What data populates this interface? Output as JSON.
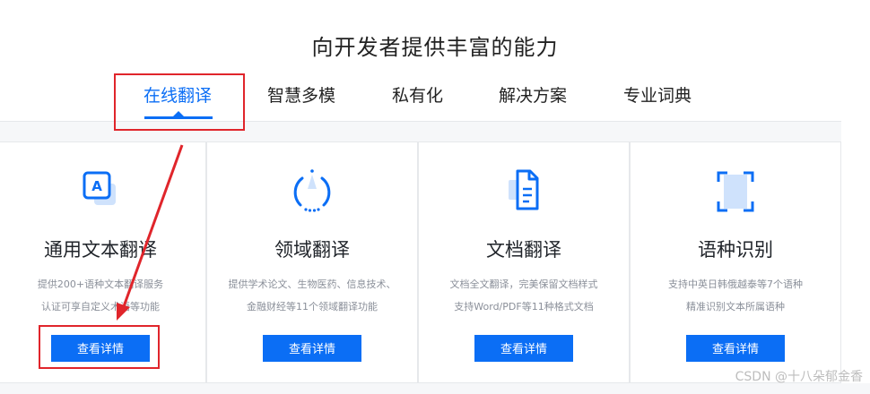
{
  "heading": "向开发者提供丰富的能力",
  "tabs": [
    {
      "label": "在线翻译",
      "active": true
    },
    {
      "label": "智慧多模",
      "active": false
    },
    {
      "label": "私有化",
      "active": false
    },
    {
      "label": "解决方案",
      "active": false
    },
    {
      "label": "专业词典",
      "active": false
    }
  ],
  "cards": [
    {
      "icon": "text-translate-icon",
      "title": "通用文本翻译",
      "desc": [
        "提供200+语种文本翻译服务",
        "认证可享自定义术语等功能"
      ],
      "button": "查看详情"
    },
    {
      "icon": "domain-translate-icon",
      "title": "领域翻译",
      "desc": [
        "提供学术论文、生物医药、信息技术、",
        "金融财经等11个领域翻译功能"
      ],
      "button": "查看详情"
    },
    {
      "icon": "document-translate-icon",
      "title": "文档翻译",
      "desc": [
        "文档全文翻译，完美保留文档样式",
        "支持Word/PDF等11种格式文档"
      ],
      "button": "查看详情"
    },
    {
      "icon": "language-detect-icon",
      "title": "语种识别",
      "desc": [
        "支持中英日韩俄越泰等7个语种",
        "精准识别文本所属语种"
      ],
      "button": "查看详情"
    }
  ],
  "watermark": "CSDN @十八朵郁金香",
  "colors": {
    "accent": "#0b6ef5",
    "annotation": "#e0252b"
  }
}
